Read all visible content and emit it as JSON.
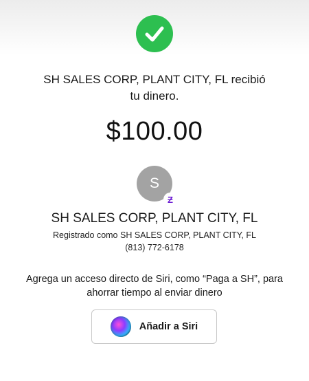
{
  "confirmation": {
    "line1": "SH SALES CORP, PLANT CITY, FL recibió",
    "line2": "tu dinero.",
    "amount": "$100.00"
  },
  "recipient": {
    "avatar_initial": "S",
    "badge_glyph": "Ƶ",
    "name": "SH SALES CORP, PLANT CITY, FL",
    "registered_as": "Registrado como SH SALES CORP, PLANT CITY, FL",
    "phone": "(813) 772-6178"
  },
  "siri": {
    "prompt_line1": "Agrega un acceso directo de Siri, como “Paga a SH”, para",
    "prompt_line2": "ahorrar tiempo al enviar dinero",
    "button_label": "Añadir a Siri"
  },
  "icons": {
    "success": "checkmark-icon",
    "siri": "siri-icon",
    "badge": "zelle-icon"
  },
  "colors": {
    "success_green": "#2dbf50",
    "avatar_gray": "#a3a3a3",
    "zelle_purple": "#6c1cd3"
  }
}
